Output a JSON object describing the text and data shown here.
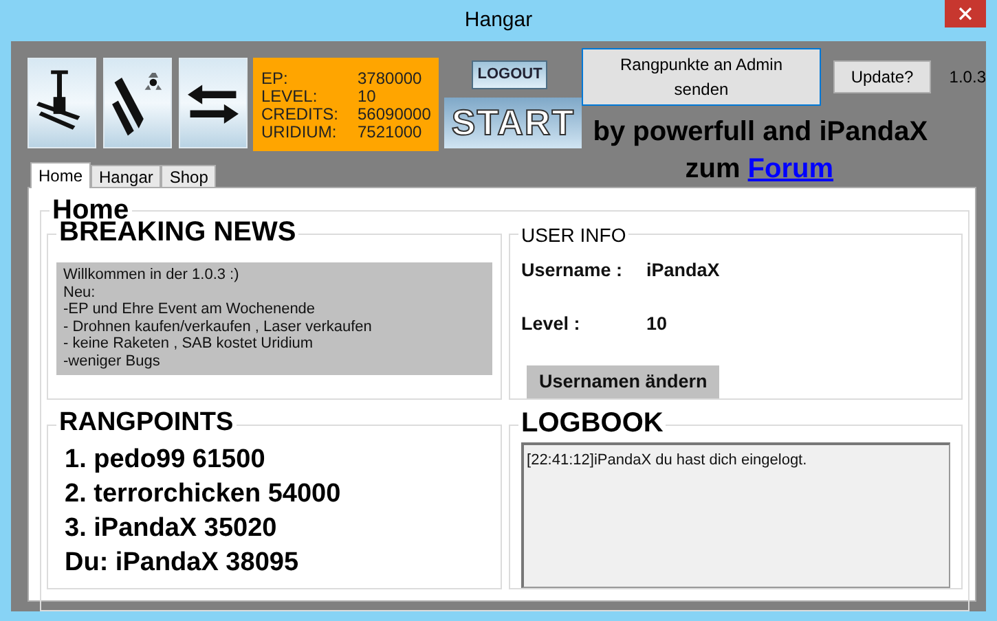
{
  "window": {
    "title": "Hangar"
  },
  "toolbar": {
    "tiles": [
      {
        "kind": "station"
      },
      {
        "kind": "rockets"
      },
      {
        "kind": "swap"
      }
    ],
    "stats": [
      {
        "label": "EP:",
        "value": "3780000"
      },
      {
        "label": "LEVEL:",
        "value": "10"
      },
      {
        "label": "CREDITS:",
        "value": "56090000"
      },
      {
        "label": "URIDIUM:",
        "value": "7521000"
      }
    ],
    "logout": "LOGOUT",
    "start": "START",
    "send_button": "Rangpunkte an Admin senden",
    "update_button": "Update?",
    "version": "1.0.3",
    "credit": "by powerfull and iPandaX",
    "forum_prefix": "zum",
    "forum_link": "Forum"
  },
  "tabs": [
    {
      "label": "Home",
      "selected": true
    },
    {
      "label": "Hangar",
      "selected": false
    },
    {
      "label": "Shop",
      "selected": false
    }
  ],
  "page_title": "Home",
  "news": {
    "title": "BREAKING NEWS",
    "lines": [
      "Willkommen in der 1.0.3 :)",
      "Neu:",
      "-EP und Ehre Event am Wochenende",
      "- Drohnen kaufen/verkaufen , Laser verkaufen",
      "- keine Raketen , SAB kostet Uridium",
      "-weniger Bugs"
    ]
  },
  "user_info": {
    "title": "USER INFO",
    "rows": [
      {
        "label": "Username :",
        "value": "iPandaX"
      },
      {
        "label": "Level :",
        "value": "10"
      }
    ],
    "button": "Usernamen ändern"
  },
  "rangpoints": {
    "title": "RANGPOINTS",
    "lines": [
      "1. pedo99 61500",
      "2. terrorchicken 54000",
      "3. iPandaX 35020",
      "Du: iPandaX 38095"
    ]
  },
  "logbook": {
    "title": "LOGBOOK",
    "entries": [
      "[22:41:12]iPandaX du hast dich eingelogt."
    ]
  }
}
